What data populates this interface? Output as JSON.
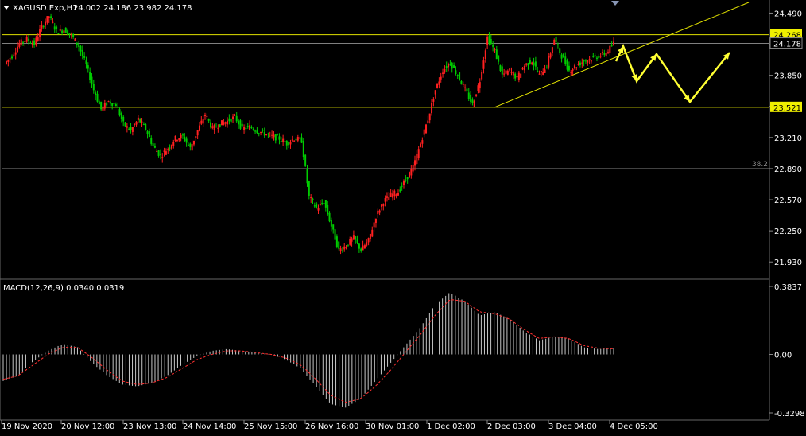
{
  "window": {
    "symbol_label": "XAGUSD.Exp,H1",
    "ohlc_label": "24.002 24.186 23.982 24.178"
  },
  "colors": {
    "background": "#000000",
    "bull_candle": "#ff2020",
    "bear_candle": "#00cc00",
    "axis_text": "#ffffff",
    "level_line": "#e0e000",
    "price_line": "#808080",
    "arrow": "#ffff33",
    "macd_hist": "#c8c8c8",
    "macd_signal": "#ff3030"
  },
  "chart_data": [
    {
      "type": "candlestick",
      "title": "XAGUSD.Exp,H1",
      "ohlc_label": "24.002 24.186 23.982 24.178",
      "ylim": [
        21.76,
        24.6
      ],
      "y_ticks": [
        "24.490",
        "24.170",
        "23.850",
        "23.530",
        "23.210",
        "22.890",
        "22.570",
        "22.250",
        "21.930"
      ],
      "y_tick_values": [
        24.49,
        24.17,
        23.85,
        23.53,
        23.21,
        22.89,
        22.57,
        22.25,
        21.93
      ],
      "x_tick_labels": [
        "19 Nov 2020",
        "20 Nov 12:00",
        "23 Nov 13:00",
        "24 Nov 14:00",
        "25 Nov 15:00",
        "26 Nov 16:00",
        "30 Nov 01:00",
        "1 Dec 02:00",
        "2 Dec 03:00",
        "3 Dec 04:00",
        "4 Dec 05:00"
      ],
      "horizontal_levels": [
        {
          "value": 24.268,
          "label": "24.268",
          "style": "highlight"
        },
        {
          "value": 23.521,
          "label": "23.521",
          "style": "highlight"
        },
        {
          "value": 24.178,
          "label": "24.178",
          "style": "current"
        }
      ],
      "fib_level": {
        "value": 22.89,
        "label": "38.2"
      },
      "price_path": [
        23.97,
        24.05,
        24.18,
        24.22,
        24.17,
        24.35,
        24.46,
        24.3,
        24.32,
        24.26,
        24.15,
        23.95,
        23.7,
        23.5,
        23.58,
        23.55,
        23.35,
        23.28,
        23.4,
        23.3,
        23.12,
        23.02,
        23.1,
        23.2,
        23.22,
        23.1,
        23.28,
        23.45,
        23.3,
        23.35,
        23.38,
        23.42,
        23.3,
        23.32,
        23.28,
        23.25,
        23.22,
        23.2,
        23.15,
        23.2,
        23.18,
        22.6,
        22.48,
        22.55,
        22.3,
        22.05,
        22.1,
        22.18,
        22.05,
        22.15,
        22.4,
        22.55,
        22.62,
        22.65,
        22.78,
        22.9,
        23.15,
        23.4,
        23.7,
        23.9,
        23.98,
        23.85,
        23.7,
        23.55,
        23.8,
        24.24,
        24.1,
        23.85,
        23.9,
        23.82,
        23.95,
        24.0,
        23.85,
        23.95,
        24.22,
        24.05,
        23.9,
        23.95,
        24.0,
        24.02,
        24.05,
        24.08,
        24.178
      ],
      "forecast_zigzag": [
        {
          "x": "4 Dec 05:00",
          "y": 24.17
        },
        {
          "x": "4 Dec 05:00",
          "y": 24.22
        },
        {
          "y": 23.8
        },
        {
          "y": 24.05
        },
        {
          "y": 23.52
        },
        {
          "y": 24.08
        }
      ]
    },
    {
      "type": "histogram",
      "title": "MACD(12,26,9) 0.0340 0.0319",
      "ylim": [
        -0.3298,
        0.3837
      ],
      "y_ticks": [
        "0.3837",
        "0.00",
        "-0.3298"
      ],
      "y_tick_values": [
        0.3837,
        0.0,
        -0.3298
      ],
      "macd_path": [
        -0.15,
        -0.12,
        -0.04,
        0.02,
        0.06,
        0.04,
        -0.05,
        -0.12,
        -0.17,
        -0.18,
        -0.16,
        -0.12,
        -0.06,
        -0.01,
        0.02,
        0.03,
        0.02,
        0.01,
        0.0,
        -0.03,
        -0.08,
        -0.18,
        -0.28,
        -0.3,
        -0.25,
        -0.15,
        -0.05,
        0.05,
        0.15,
        0.28,
        0.35,
        0.3,
        0.22,
        0.24,
        0.2,
        0.13,
        0.08,
        0.1,
        0.09,
        0.04,
        0.03,
        0.034
      ],
      "signal_path": [
        -0.14,
        -0.12,
        -0.06,
        0.0,
        0.04,
        0.04,
        -0.02,
        -0.09,
        -0.15,
        -0.17,
        -0.16,
        -0.13,
        -0.08,
        -0.03,
        0.0,
        0.02,
        0.02,
        0.01,
        0.0,
        -0.02,
        -0.06,
        -0.14,
        -0.23,
        -0.27,
        -0.25,
        -0.18,
        -0.09,
        0.01,
        0.11,
        0.22,
        0.31,
        0.3,
        0.24,
        0.23,
        0.2,
        0.14,
        0.09,
        0.1,
        0.09,
        0.05,
        0.035,
        0.0319
      ]
    }
  ]
}
